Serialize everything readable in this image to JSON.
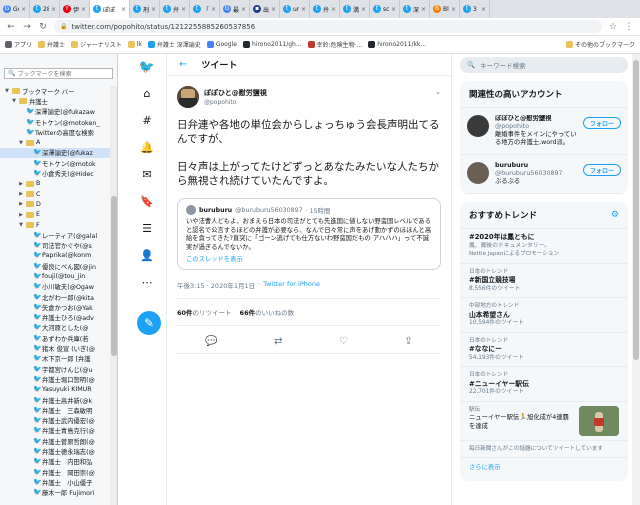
{
  "tabs": [
    {
      "title": "Goo",
      "fav": "G",
      "color": "#4285f4"
    },
    {
      "title": "28",
      "fav": "t",
      "color": "#1da1f2"
    },
    {
      "title": "伊藤",
      "fav": "Y",
      "color": "#e60012"
    },
    {
      "title": "ぽぽ",
      "fav": "t",
      "color": "#1da1f2",
      "active": true
    },
    {
      "title": "刑",
      "fav": "t",
      "color": "#1da1f2"
    },
    {
      "title": "弁護",
      "fav": "t",
      "color": "#1da1f2"
    },
    {
      "title": "「世",
      "fav": "t",
      "color": "#1da1f2"
    },
    {
      "title": "最",
      "fav": "G",
      "color": "#4285f4"
    },
    {
      "title": "出",
      "fav": "▪",
      "color": "#1e3a8a"
    },
    {
      "title": "url",
      "fav": "t",
      "color": "#1da1f2"
    },
    {
      "title": "弁",
      "fav": "t",
      "color": "#1da1f2"
    },
    {
      "title": "満",
      "fav": "t",
      "color": "#1da1f2"
    },
    {
      "title": "sc",
      "fav": "t",
      "color": "#1da1f2"
    },
    {
      "title": "深",
      "fav": "t",
      "color": "#1da1f2"
    },
    {
      "title": "Blo",
      "fav": "B",
      "color": "#f57d00"
    },
    {
      "title": "3",
      "fav": "t",
      "color": "#1da1f2"
    }
  ],
  "toolbar": {
    "url": "twitter.com/popohito/status/1212255885260537856"
  },
  "bookmarks_bar": {
    "items": [
      {
        "label": "アプリ",
        "color": "#5f6368"
      },
      {
        "label": "弁護士",
        "color": "#e8c35a"
      },
      {
        "label": "ジャーナリスト",
        "color": "#e8c35a"
      },
      {
        "label": "lk",
        "color": "#e8c35a"
      },
      {
        "label": "弁護士 深澤諭史",
        "color": "#1da1f2"
      },
      {
        "label": "Google",
        "color": "#4285f4"
      },
      {
        "label": "hirono2011/gh...",
        "color": "#24292e"
      },
      {
        "label": "幸鈴:危険生物·...",
        "color": "#c0392b"
      },
      {
        "label": "hirono2011/kk...",
        "color": "#24292e"
      }
    ],
    "other": "その他のブックマーク"
  },
  "sidebar": {
    "search_placeholder": "ブックマークを検索",
    "rows": [
      {
        "indent": 0,
        "type": "folder",
        "arrow": "▼",
        "label": "ブックマーク バー"
      },
      {
        "indent": 1,
        "type": "folder",
        "arrow": "▼",
        "label": "弁護士"
      },
      {
        "indent": 2,
        "type": "bird",
        "label": "深澤諭史(@fukazaw"
      },
      {
        "indent": 2,
        "type": "bird",
        "label": "モトケン(@motoken_"
      },
      {
        "indent": 2,
        "type": "bird",
        "label": "Twitterの高度な検索"
      },
      {
        "indent": 2,
        "type": "folder",
        "arrow": "▼",
        "label": "A"
      },
      {
        "indent": 3,
        "type": "bird",
        "label": "深澤諭史(@fukaz",
        "sel": true
      },
      {
        "indent": 3,
        "type": "bird",
        "label": "モトケン(@motok"
      },
      {
        "indent": 3,
        "type": "bird",
        "label": "小倉秀夫(@Hidec"
      },
      {
        "indent": 2,
        "type": "folder",
        "arrow": "▶",
        "label": "B"
      },
      {
        "indent": 2,
        "type": "folder",
        "arrow": "▶",
        "label": "C"
      },
      {
        "indent": 2,
        "type": "folder",
        "arrow": "▶",
        "label": "D"
      },
      {
        "indent": 2,
        "type": "folder",
        "arrow": "▶",
        "label": "E"
      },
      {
        "indent": 2,
        "type": "folder",
        "arrow": "▼",
        "label": "F"
      },
      {
        "indent": 3,
        "type": "bird",
        "label": "レーティア(@galal"
      },
      {
        "indent": 3,
        "type": "bird",
        "label": "司法官かぐや(@s"
      },
      {
        "indent": 3,
        "type": "bird",
        "label": "Paprika(@konm"
      },
      {
        "indent": 3,
        "type": "bird",
        "label": "優良にべん図(@jin"
      },
      {
        "indent": 3,
        "type": "bird",
        "label": "fouji(@tou_jin"
      },
      {
        "indent": 3,
        "type": "bird",
        "label": "小川敏夫(@Ogaw"
      },
      {
        "indent": 3,
        "type": "bird",
        "label": "北がわ一郎(@kita"
      },
      {
        "indent": 3,
        "type": "bird",
        "label": "矢倉かつお(@Yak"
      },
      {
        "indent": 3,
        "type": "bird",
        "label": "弁護士ひろ(@adv"
      },
      {
        "indent": 3,
        "type": "bird",
        "label": "大河原とした(@"
      },
      {
        "indent": 3,
        "type": "bird",
        "label": "あずわか兵庫(若"
      },
      {
        "indent": 3,
        "type": "bird",
        "label": "猪木 俊宣 (いぎ(@"
      },
      {
        "indent": 3,
        "type": "bird",
        "label": "木下京一郎 [弁護"
      },
      {
        "indent": 3,
        "type": "bird",
        "label": "宇都宮けんじ(@u"
      },
      {
        "indent": 3,
        "type": "bird",
        "label": "弁護士堀口惣明(@"
      },
      {
        "indent": 3,
        "type": "bird",
        "label": "Yasuyuki KIMUR"
      },
      {
        "indent": 3,
        "type": "bird",
        "label": "弁護士高井新(@k"
      },
      {
        "indent": 3,
        "type": "bird",
        "label": "弁護士　三森敏明"
      },
      {
        "indent": 3,
        "type": "bird",
        "label": "弁護士武内優宏(@"
      },
      {
        "indent": 3,
        "type": "bird",
        "label": "弁護士青島克行(@"
      },
      {
        "indent": 3,
        "type": "bird",
        "label": "弁護士菅原哲朗(@"
      },
      {
        "indent": 3,
        "type": "bird",
        "label": "弁護士德永瑞志(@"
      },
      {
        "indent": 3,
        "type": "bird",
        "label": "弁護士　内田和弘"
      },
      {
        "indent": 3,
        "type": "bird",
        "label": "弁護士　岡田崇(@"
      },
      {
        "indent": 3,
        "type": "bird",
        "label": "弁護士　小山優子"
      },
      {
        "indent": 3,
        "type": "bird",
        "label": "藤木一郎 Fujimori"
      }
    ]
  },
  "nav": {
    "compose": "✎"
  },
  "main": {
    "header_title": "ツイート",
    "author_name": "ぽぽひと@慰労鹽視",
    "author_handle": "@popohito",
    "text": "日弁連や各地の単位会からしょっちゅう会長声明出てるんですが、\n\n日々声は上がってたけどずっとあなたみたいな人たちから無視され続けていたんですよ。",
    "quote": {
      "name": "buruburu",
      "handle": "@buruburu56030897",
      "time": "· 15時間",
      "text": "いや法曹人どもよ、おまえら日本の司法がとても先進国に値しない野蛮国レベルであると認名で公言するほどの弁護が必要なら、なんで日々常に声をあげ動かずのほほんと高給を貪ってきた?直突に「ゴーン逃げても仕方ないわ野蛮国だもの アハハハ」って不誠実が過ぎるんでないか。",
      "link": "このスレッドを表示"
    },
    "time": "午後3:15 · 2020年1月1日",
    "source": "Twitter for iPhone",
    "retweets_num": "60件",
    "retweets_label": "のリツイート",
    "likes_num": "66件",
    "likes_label": "のいいねの数"
  },
  "right": {
    "search_placeholder": "キーワード検索",
    "follow_title": "関連性の高いアカウント",
    "follow_label": "フォロー",
    "accounts": [
      {
        "name": "ぽぽひと@慰労鹽視",
        "handle": "@popohito",
        "bio": "離婚事件をメインにやっている地方の弁護士,word派。"
      },
      {
        "name": "buruburu",
        "handle": "@buruburu56030897",
        "bio": "ぶるぶる"
      }
    ],
    "trends_title": "おすすめトレンド",
    "trends": [
      {
        "name": "#2020年は鳳ともに",
        "desc": "鳳、鳳後のドキュメンタリー。",
        "promo": "Nettle Japanによるプロモーション"
      },
      {
        "ctx": "日本のトレンド",
        "name": "#新国立競技場",
        "count": "8,556件のツイート"
      },
      {
        "ctx": "中部地方のトレンド",
        "name": "山本希望さん",
        "count": "10,594件のツイート"
      },
      {
        "ctx": "日本のトレンド",
        "name": "#ななにー",
        "count": "54,193件のツイート"
      },
      {
        "ctx": "日本のトレンド",
        "name": "#ニューイヤー駅伝",
        "count": "22,701件のツイート"
      }
    ],
    "news": {
      "ctx": "駅伝",
      "text": "ニューイヤー駅伝🏃旭化成が4連覇を達成",
      "footer": "毎日新聞さんがこの話題についてツイートしています"
    },
    "more": "さらに表示"
  }
}
